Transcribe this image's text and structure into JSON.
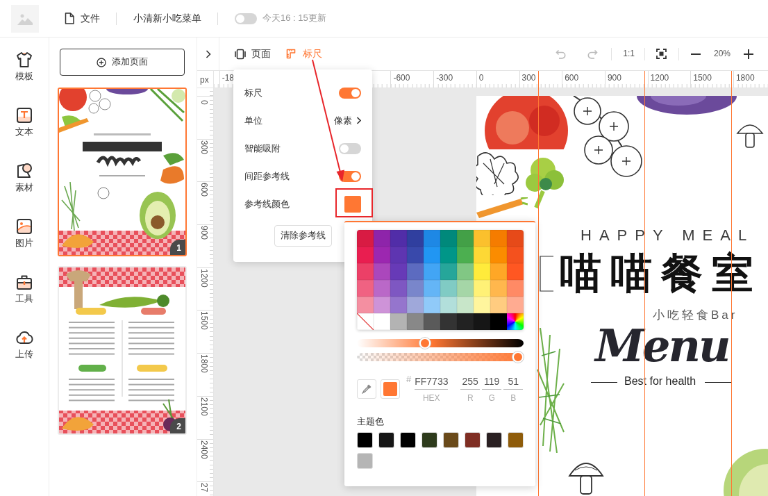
{
  "app_bar": {
    "file_menu": "文件",
    "document_title": "小清新小吃菜单",
    "autosave": {
      "on": false,
      "status": "今天16 : 15更新"
    }
  },
  "side_nav": [
    {
      "label": "模板"
    },
    {
      "label": "文本"
    },
    {
      "label": "素材"
    },
    {
      "label": "图片"
    },
    {
      "label": "工具"
    },
    {
      "label": "上传"
    }
  ],
  "pages_panel": {
    "add_button": "添加页面",
    "pages": [
      {
        "kind": "cover",
        "number": "1",
        "selected": true
      },
      {
        "kind": "menu_list",
        "number": "2",
        "selected": false
      }
    ]
  },
  "toolbar": {
    "tabs": [
      {
        "label": "页面",
        "selected": false
      },
      {
        "label": "标尺",
        "selected": true
      }
    ],
    "undo": {
      "disabled": true
    },
    "redo": {
      "disabled": true
    },
    "actual_size": "1:1",
    "zoom": "20%"
  },
  "rulers": {
    "unit": "px",
    "horizontal": [
      "-18",
      "-600",
      "-300",
      "0",
      "300",
      "600",
      "900",
      "1200",
      "1500",
      "1800"
    ],
    "vertical": [
      "0",
      "300",
      "600",
      "900",
      "1200",
      "1500",
      "1800",
      "2100",
      "2400",
      "27"
    ]
  },
  "ruler_menu": {
    "rows": [
      {
        "kind": "toggle",
        "label": "标尺",
        "on": true
      },
      {
        "kind": "select",
        "label": "单位",
        "value": "像素"
      },
      {
        "kind": "toggle",
        "label": "智能吸附",
        "on": false
      },
      {
        "kind": "toggle",
        "label": "间距参考线",
        "on": true
      },
      {
        "kind": "color",
        "label": "参考线颜色",
        "color": "#ff7733"
      }
    ],
    "clear_button": "清除参考线"
  },
  "color_picker": {
    "swatches": [
      {
        "kind": "solid",
        "color": "#d81b43"
      },
      {
        "kind": "solid",
        "color": "#8e24aa"
      },
      {
        "kind": "solid",
        "color": "#512da8"
      },
      {
        "kind": "solid",
        "color": "#303f9f"
      },
      {
        "kind": "solid",
        "color": "#1e88e5"
      },
      {
        "kind": "solid",
        "color": "#00897b"
      },
      {
        "kind": "solid",
        "color": "#43a047"
      },
      {
        "kind": "solid",
        "color": "#fbc02d"
      },
      {
        "kind": "solid",
        "color": "#f57c00"
      },
      {
        "kind": "solid",
        "color": "#e64a19"
      },
      {
        "kind": "solid",
        "color": "#e91e50"
      },
      {
        "kind": "solid",
        "color": "#9c27b0"
      },
      {
        "kind": "solid",
        "color": "#5e35b1"
      },
      {
        "kind": "solid",
        "color": "#3949ab"
      },
      {
        "kind": "solid",
        "color": "#2196f3"
      },
      {
        "kind": "solid",
        "color": "#009688"
      },
      {
        "kind": "solid",
        "color": "#4caf50"
      },
      {
        "kind": "solid",
        "color": "#fdd835"
      },
      {
        "kind": "solid",
        "color": "#fb8c00"
      },
      {
        "kind": "solid",
        "color": "#f4511e"
      },
      {
        "kind": "solid",
        "color": "#ec4067"
      },
      {
        "kind": "solid",
        "color": "#ab47bc"
      },
      {
        "kind": "solid",
        "color": "#673ab7"
      },
      {
        "kind": "solid",
        "color": "#5c6bc0"
      },
      {
        "kind": "solid",
        "color": "#42a5f5"
      },
      {
        "kind": "solid",
        "color": "#26a69a"
      },
      {
        "kind": "solid",
        "color": "#81c784"
      },
      {
        "kind": "solid",
        "color": "#ffeb3b"
      },
      {
        "kind": "solid",
        "color": "#ffa726"
      },
      {
        "kind": "solid",
        "color": "#ff5722"
      },
      {
        "kind": "solid",
        "color": "#f06282"
      },
      {
        "kind": "solid",
        "color": "#ba68c8"
      },
      {
        "kind": "solid",
        "color": "#7e57c2"
      },
      {
        "kind": "solid",
        "color": "#7986cb"
      },
      {
        "kind": "solid",
        "color": "#64b5f6"
      },
      {
        "kind": "solid",
        "color": "#80cbc4"
      },
      {
        "kind": "solid",
        "color": "#a5d6a7"
      },
      {
        "kind": "solid",
        "color": "#fff176"
      },
      {
        "kind": "solid",
        "color": "#ffb74d"
      },
      {
        "kind": "solid",
        "color": "#ff8a65"
      },
      {
        "kind": "solid",
        "color": "#f48fa1"
      },
      {
        "kind": "solid",
        "color": "#ce93d8"
      },
      {
        "kind": "solid",
        "color": "#9575cd"
      },
      {
        "kind": "solid",
        "color": "#9fa8da"
      },
      {
        "kind": "solid",
        "color": "#90caf9"
      },
      {
        "kind": "solid",
        "color": "#b2dfdb"
      },
      {
        "kind": "solid",
        "color": "#c8e6c9"
      },
      {
        "kind": "solid",
        "color": "#fff59d"
      },
      {
        "kind": "solid",
        "color": "#ffcc80"
      },
      {
        "kind": "solid",
        "color": "#ffab91"
      },
      {
        "kind": "none"
      },
      {
        "kind": "solid",
        "color": "#ffffff"
      },
      {
        "kind": "solid",
        "color": "#b3b3b3"
      },
      {
        "kind": "solid",
        "color": "#888888"
      },
      {
        "kind": "solid",
        "color": "#5a5a5a"
      },
      {
        "kind": "solid",
        "color": "#333333"
      },
      {
        "kind": "solid",
        "color": "#222222"
      },
      {
        "kind": "solid",
        "color": "#161616"
      },
      {
        "kind": "solid",
        "color": "#000000"
      },
      {
        "kind": "spectrum"
      }
    ],
    "shade": {
      "level": 0.4
    },
    "opacity": {
      "level": 1
    },
    "prefix": "#",
    "fields": [
      {
        "value": "FF7733",
        "label": "HEX"
      },
      {
        "value": "255",
        "label": "R"
      },
      {
        "value": "119",
        "label": "G"
      },
      {
        "value": "51",
        "label": "B"
      }
    ],
    "theme_title": "主题色",
    "theme_colors": [
      {
        "color": "#000000"
      },
      {
        "color": "#161616"
      },
      {
        "color": "#000000"
      },
      {
        "color": "#2e3b1c"
      },
      {
        "color": "#6a4a1a"
      },
      {
        "color": "#7f2e23"
      },
      {
        "color": "#2a2022"
      },
      {
        "color": "#8f5c0a"
      },
      {
        "color": "#b5b5b5"
      }
    ]
  },
  "design_page": {
    "headline": "HAPPY MEAL",
    "title": "喵喵餐室",
    "subtitle": "小吃轻食Bar",
    "script_title": "Menu",
    "tagline": "Best for health"
  }
}
